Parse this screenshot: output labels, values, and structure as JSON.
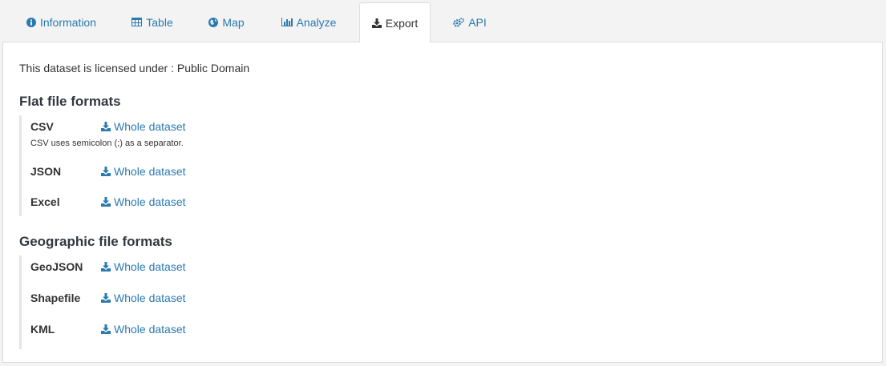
{
  "tabs": [
    {
      "label": "Information",
      "icon": "info-circle-icon"
    },
    {
      "label": "Table",
      "icon": "table-icon"
    },
    {
      "label": "Map",
      "icon": "globe-icon"
    },
    {
      "label": "Analyze",
      "icon": "bar-chart-icon"
    },
    {
      "label": "Export",
      "icon": "download-icon",
      "active": true
    },
    {
      "label": "API",
      "icon": "gears-icon"
    }
  ],
  "license": "This dataset is licensed under : Public Domain",
  "flat": {
    "title": "Flat file formats",
    "formats": [
      {
        "name": "CSV",
        "link": "Whole dataset",
        "note": "CSV uses semicolon (;) as a separator."
      },
      {
        "name": "JSON",
        "link": "Whole dataset"
      },
      {
        "name": "Excel",
        "link": "Whole dataset"
      }
    ]
  },
  "geo": {
    "title": "Geographic file formats",
    "formats": [
      {
        "name": "GeoJSON",
        "link": "Whole dataset"
      },
      {
        "name": "Shapefile",
        "link": "Whole dataset"
      },
      {
        "name": "KML",
        "link": "Whole dataset"
      }
    ]
  },
  "colors": {
    "link": "#2a7ab0",
    "text": "#333333",
    "background": "#f3f3f3"
  }
}
